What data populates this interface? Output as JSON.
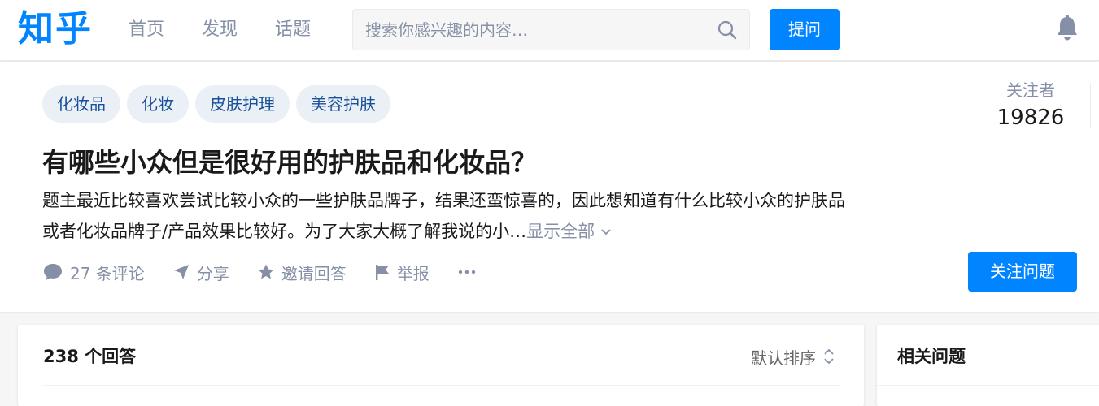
{
  "header": {
    "logo": "知乎",
    "nav": {
      "home": "首页",
      "explore": "发现",
      "topics": "话题"
    },
    "search": {
      "placeholder": "搜索你感兴趣的内容…"
    },
    "ask_button": "提问",
    "icons": {
      "search": "search-icon",
      "notifications": "bell-icon"
    }
  },
  "question": {
    "topics": [
      "化妆品",
      "化妆",
      "皮肤护理",
      "美容护肤"
    ],
    "followers": {
      "label": "关注者",
      "count": "19826"
    },
    "title": "有哪些小众但是很好用的护肤品和化妆品？",
    "detail": "题主最近比较喜欢尝试比较小众的一些护肤品牌子，结果还蛮惊喜的，因此想知道有什么比较小众的护肤品或者化妆品牌子/产品效果比较好。为了大家大概了解我说的小…",
    "show_all": "显示全部",
    "actions": {
      "comments": "27 条评论",
      "share": "分享",
      "invite": "邀请回答",
      "report": "举报"
    },
    "follow_button": "关注问题"
  },
  "answers": {
    "count_label": "238 个回答",
    "sort_label": "默认排序"
  },
  "sidebar": {
    "related_title": "相关问题"
  },
  "colors": {
    "brand": "#0084ff",
    "tag_bg": "#ebf0f6",
    "tag_text": "#175199",
    "muted": "#8590a6"
  }
}
